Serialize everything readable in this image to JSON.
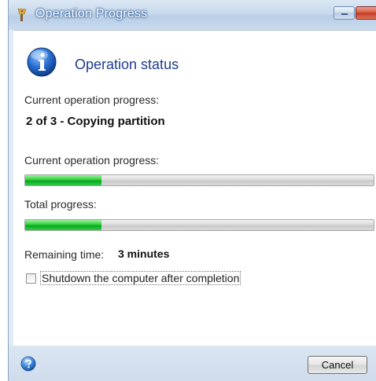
{
  "window": {
    "title": "Operation Progress",
    "title_icon": "wizard-icon"
  },
  "header": {
    "title": "Operation status",
    "icon": "info-icon"
  },
  "step": {
    "label": "Current operation progress:",
    "value": "2 of 3 - Copying partition"
  },
  "current_progress": {
    "label": "Current operation progress:",
    "fraction": 0.22
  },
  "total_progress": {
    "label": "Total progress:",
    "fraction": 0.22
  },
  "remaining": {
    "label": "Remaining time:",
    "value": "3 minutes"
  },
  "shutdown_option": {
    "label": "Shutdown the computer after completion",
    "checked": false
  },
  "footer": {
    "cancel_label": "Cancel",
    "help_icon": "help-icon"
  },
  "colors": {
    "progress_fill": "#1fbf35",
    "header_title": "#1e3c8c",
    "title_bar": "#c7d9ec"
  }
}
